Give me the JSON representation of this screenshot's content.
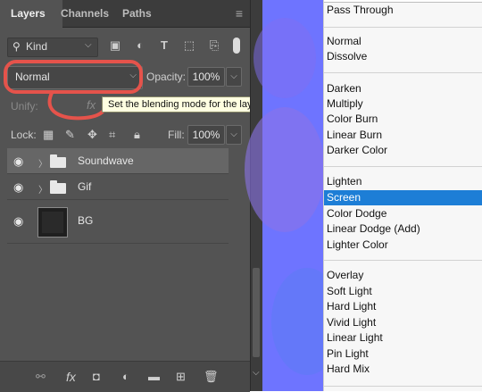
{
  "layers_panel": {
    "tabs": [
      "Layers",
      "Channels",
      "Paths"
    ],
    "filter_kind": "Kind",
    "blend_mode": "Normal",
    "opacity_label": "Opacity:",
    "opacity_value": "100%",
    "unify_label": "Unify:",
    "tooltip": "Set the blending mode for the layer",
    "lock_label": "Lock:",
    "fill_label": "Fill:",
    "fill_value": "100%",
    "layers": [
      {
        "name": "Soundwave",
        "type": "group",
        "visible": true,
        "selected": true
      },
      {
        "name": "Gif",
        "type": "group",
        "visible": true,
        "selected": false
      },
      {
        "name": "BG",
        "type": "layer",
        "visible": true,
        "selected": false
      }
    ],
    "fx_label": "fx",
    "annotation_color": "#e5534b"
  },
  "blend_menu": {
    "selected": "Screen",
    "groups": [
      [
        "Pass Through"
      ],
      [
        "Normal",
        "Dissolve"
      ],
      [
        "Darken",
        "Multiply",
        "Color Burn",
        "Linear Burn",
        "Darker Color"
      ],
      [
        "Lighten",
        "Screen",
        "Color Dodge",
        "Linear Dodge (Add)",
        "Lighter Color"
      ],
      [
        "Overlay",
        "Soft Light",
        "Hard Light",
        "Vivid Light",
        "Linear Light",
        "Pin Light",
        "Hard Mix"
      ]
    ],
    "accent_color": "#1d7ed6"
  }
}
